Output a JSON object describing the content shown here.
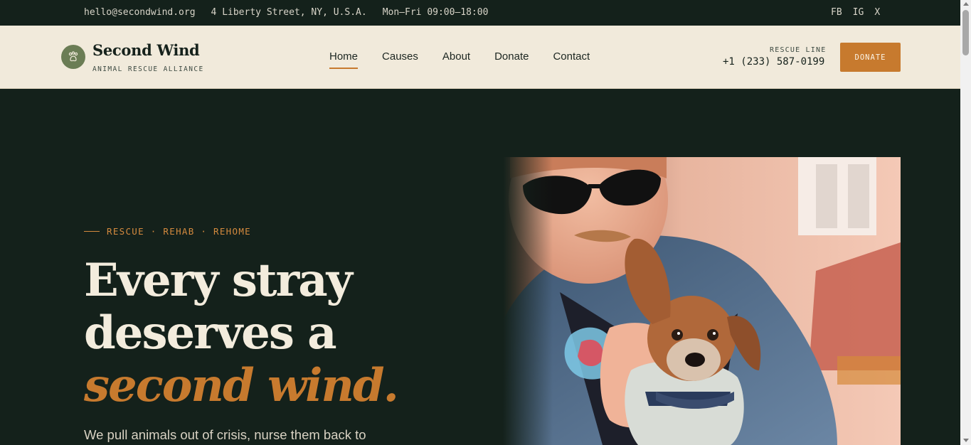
{
  "topbar": {
    "email": "hello@secondwind.org",
    "address": "4 Liberty Street, NY, U.S.A.",
    "hours": "Mon–Fri 09:00–18:00",
    "social": [
      "FB",
      "IG",
      "X"
    ]
  },
  "header": {
    "brand": "Second Wind",
    "tagline": "ANIMAL RESCUE ALLIANCE",
    "logo_icon": "paw-icon",
    "nav": [
      {
        "label": "Home",
        "active": true
      },
      {
        "label": "Causes",
        "active": false
      },
      {
        "label": "About",
        "active": false
      },
      {
        "label": "Donate",
        "active": false
      },
      {
        "label": "Contact",
        "active": false
      }
    ],
    "rescue_label": "RESCUE LINE",
    "rescue_phone": "+1 (233) 587-0199",
    "donate_button": "DONATE"
  },
  "hero": {
    "eyebrow": "RESCUE · REHAB · REHOME",
    "headline_start": "Every stray deserves a ",
    "headline_accent": "second wind.",
    "lede": "We pull animals out of crisis, nurse them back to",
    "image_alt_icon": "man-with-dog-photo"
  },
  "colors": {
    "dark": "#14211b",
    "cream": "#f1eadb",
    "accent": "#c77a2e",
    "logo_green": "#6b7d55"
  }
}
